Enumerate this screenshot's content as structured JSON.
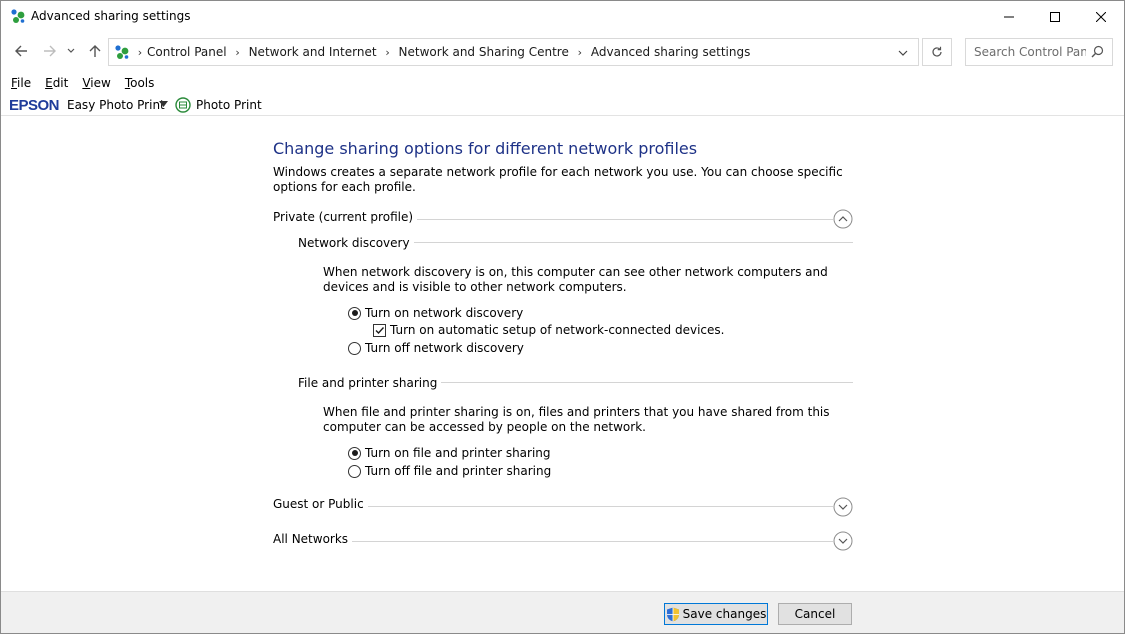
{
  "window": {
    "title": "Advanced sharing settings"
  },
  "nav": {
    "breadcrumbs": [
      "Control Panel",
      "Network and Internet",
      "Network and Sharing Centre",
      "Advanced sharing settings"
    ],
    "search_placeholder": "Search Control Panel"
  },
  "menu": {
    "file": "ile",
    "file_u": "F",
    "edit": "dit",
    "edit_u": "E",
    "view": "iew",
    "view_u": "V",
    "tools": "ools",
    "tools_u": "T"
  },
  "epson": {
    "logo": "EPSON",
    "easy_photo_print": "Easy Photo Print",
    "photo_print": "Photo Print"
  },
  "main": {
    "title": "Change sharing options for different network profiles",
    "intro": "Windows creates a separate network profile for each network you use. You can choose specific options for each profile.",
    "private_profile": {
      "label": "Private (current profile)",
      "expanded": true,
      "network_discovery": {
        "label": "Network discovery",
        "description": "When network discovery is on, this computer can see other network computers and devices and is visible to other network computers.",
        "turn_on": "Turn on network discovery",
        "auto_setup": "Turn on automatic setup of network-connected devices.",
        "turn_off": "Turn off network discovery",
        "selected": "on",
        "auto_setup_checked": true
      },
      "file_printer_sharing": {
        "label": "File and printer sharing",
        "description": "When file and printer sharing is on, files and printers that you have shared from this computer can be accessed by people on the network.",
        "turn_on": "Turn on file and printer sharing",
        "turn_off": "Turn off file and printer sharing",
        "selected": "on"
      }
    },
    "guest_public": {
      "label": "Guest or Public",
      "expanded": false
    },
    "all_networks": {
      "label": "All Networks",
      "expanded": false
    }
  },
  "footer": {
    "save": "Save changes",
    "cancel": "Cancel"
  },
  "colors": {
    "title_blue": "#1e3287",
    "epson_blue": "#1f3c9a",
    "button_focus": "#0078d7",
    "footer_bg": "#f0f0f0"
  }
}
